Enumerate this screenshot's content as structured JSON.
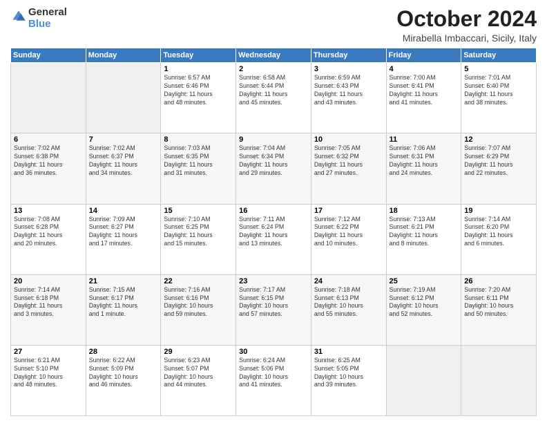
{
  "header": {
    "logo_line1": "General",
    "logo_line2": "Blue",
    "title": "October 2024",
    "location": "Mirabella Imbaccari, Sicily, Italy"
  },
  "days_of_week": [
    "Sunday",
    "Monday",
    "Tuesday",
    "Wednesday",
    "Thursday",
    "Friday",
    "Saturday"
  ],
  "weeks": [
    [
      {
        "day": "",
        "info": ""
      },
      {
        "day": "",
        "info": ""
      },
      {
        "day": "1",
        "info": "Sunrise: 6:57 AM\nSunset: 6:46 PM\nDaylight: 11 hours\nand 48 minutes."
      },
      {
        "day": "2",
        "info": "Sunrise: 6:58 AM\nSunset: 6:44 PM\nDaylight: 11 hours\nand 45 minutes."
      },
      {
        "day": "3",
        "info": "Sunrise: 6:59 AM\nSunset: 6:43 PM\nDaylight: 11 hours\nand 43 minutes."
      },
      {
        "day": "4",
        "info": "Sunrise: 7:00 AM\nSunset: 6:41 PM\nDaylight: 11 hours\nand 41 minutes."
      },
      {
        "day": "5",
        "info": "Sunrise: 7:01 AM\nSunset: 6:40 PM\nDaylight: 11 hours\nand 38 minutes."
      }
    ],
    [
      {
        "day": "6",
        "info": "Sunrise: 7:02 AM\nSunset: 6:38 PM\nDaylight: 11 hours\nand 36 minutes."
      },
      {
        "day": "7",
        "info": "Sunrise: 7:02 AM\nSunset: 6:37 PM\nDaylight: 11 hours\nand 34 minutes."
      },
      {
        "day": "8",
        "info": "Sunrise: 7:03 AM\nSunset: 6:35 PM\nDaylight: 11 hours\nand 31 minutes."
      },
      {
        "day": "9",
        "info": "Sunrise: 7:04 AM\nSunset: 6:34 PM\nDaylight: 11 hours\nand 29 minutes."
      },
      {
        "day": "10",
        "info": "Sunrise: 7:05 AM\nSunset: 6:32 PM\nDaylight: 11 hours\nand 27 minutes."
      },
      {
        "day": "11",
        "info": "Sunrise: 7:06 AM\nSunset: 6:31 PM\nDaylight: 11 hours\nand 24 minutes."
      },
      {
        "day": "12",
        "info": "Sunrise: 7:07 AM\nSunset: 6:29 PM\nDaylight: 11 hours\nand 22 minutes."
      }
    ],
    [
      {
        "day": "13",
        "info": "Sunrise: 7:08 AM\nSunset: 6:28 PM\nDaylight: 11 hours\nand 20 minutes."
      },
      {
        "day": "14",
        "info": "Sunrise: 7:09 AM\nSunset: 6:27 PM\nDaylight: 11 hours\nand 17 minutes."
      },
      {
        "day": "15",
        "info": "Sunrise: 7:10 AM\nSunset: 6:25 PM\nDaylight: 11 hours\nand 15 minutes."
      },
      {
        "day": "16",
        "info": "Sunrise: 7:11 AM\nSunset: 6:24 PM\nDaylight: 11 hours\nand 13 minutes."
      },
      {
        "day": "17",
        "info": "Sunrise: 7:12 AM\nSunset: 6:22 PM\nDaylight: 11 hours\nand 10 minutes."
      },
      {
        "day": "18",
        "info": "Sunrise: 7:13 AM\nSunset: 6:21 PM\nDaylight: 11 hours\nand 8 minutes."
      },
      {
        "day": "19",
        "info": "Sunrise: 7:14 AM\nSunset: 6:20 PM\nDaylight: 11 hours\nand 6 minutes."
      }
    ],
    [
      {
        "day": "20",
        "info": "Sunrise: 7:14 AM\nSunset: 6:18 PM\nDaylight: 11 hours\nand 3 minutes."
      },
      {
        "day": "21",
        "info": "Sunrise: 7:15 AM\nSunset: 6:17 PM\nDaylight: 11 hours\nand 1 minute."
      },
      {
        "day": "22",
        "info": "Sunrise: 7:16 AM\nSunset: 6:16 PM\nDaylight: 10 hours\nand 59 minutes."
      },
      {
        "day": "23",
        "info": "Sunrise: 7:17 AM\nSunset: 6:15 PM\nDaylight: 10 hours\nand 57 minutes."
      },
      {
        "day": "24",
        "info": "Sunrise: 7:18 AM\nSunset: 6:13 PM\nDaylight: 10 hours\nand 55 minutes."
      },
      {
        "day": "25",
        "info": "Sunrise: 7:19 AM\nSunset: 6:12 PM\nDaylight: 10 hours\nand 52 minutes."
      },
      {
        "day": "26",
        "info": "Sunrise: 7:20 AM\nSunset: 6:11 PM\nDaylight: 10 hours\nand 50 minutes."
      }
    ],
    [
      {
        "day": "27",
        "info": "Sunrise: 6:21 AM\nSunset: 5:10 PM\nDaylight: 10 hours\nand 48 minutes."
      },
      {
        "day": "28",
        "info": "Sunrise: 6:22 AM\nSunset: 5:09 PM\nDaylight: 10 hours\nand 46 minutes."
      },
      {
        "day": "29",
        "info": "Sunrise: 6:23 AM\nSunset: 5:07 PM\nDaylight: 10 hours\nand 44 minutes."
      },
      {
        "day": "30",
        "info": "Sunrise: 6:24 AM\nSunset: 5:06 PM\nDaylight: 10 hours\nand 41 minutes."
      },
      {
        "day": "31",
        "info": "Sunrise: 6:25 AM\nSunset: 5:05 PM\nDaylight: 10 hours\nand 39 minutes."
      },
      {
        "day": "",
        "info": ""
      },
      {
        "day": "",
        "info": ""
      }
    ]
  ]
}
